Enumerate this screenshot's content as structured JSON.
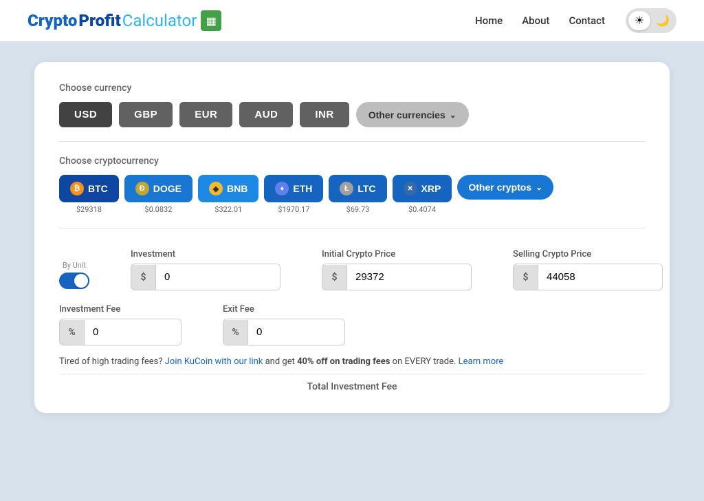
{
  "nav": {
    "logo": {
      "part1": "Crypto",
      "part2": "Profit",
      "part3": "Calculator",
      "icon": "▦"
    },
    "links": [
      {
        "label": "Home",
        "href": "#"
      },
      {
        "label": "About",
        "href": "#"
      },
      {
        "label": "Contact",
        "href": "#"
      }
    ],
    "theme": {
      "light_icon": "☀",
      "dark_icon": "🌙"
    }
  },
  "currency": {
    "section_label": "Choose currency",
    "buttons": [
      {
        "label": "USD",
        "active": true
      },
      {
        "label": "GBP",
        "active": false
      },
      {
        "label": "EUR",
        "active": false
      },
      {
        "label": "AUD",
        "active": false
      },
      {
        "label": "INR",
        "active": false
      }
    ],
    "other_label": "Other currencies",
    "other_icon": "⌄"
  },
  "crypto": {
    "section_label": "Choose cryptocurrency",
    "coins": [
      {
        "id": "btc",
        "label": "BTC",
        "price": "$29318",
        "icon": "₿",
        "icon_class": "coin-btc"
      },
      {
        "id": "doge",
        "label": "DOGE",
        "price": "$0.0832",
        "icon": "Ð",
        "icon_class": "coin-doge"
      },
      {
        "id": "bnb",
        "label": "BNB",
        "price": "$322.01",
        "icon": "◆",
        "icon_class": "coin-bnb"
      },
      {
        "id": "eth",
        "label": "ETH",
        "price": "$1970.17",
        "icon": "♦",
        "icon_class": "coin-eth"
      },
      {
        "id": "ltc",
        "label": "LTC",
        "price": "$69.73",
        "icon": "Ł",
        "icon_class": "coin-ltc"
      },
      {
        "id": "xrp",
        "label": "XRP",
        "price": "$0.4074",
        "icon": "✕",
        "icon_class": "coin-xrp"
      }
    ],
    "other_label": "Other cryptos",
    "other_icon": "⌄"
  },
  "form": {
    "by_unit": "By Unit",
    "investment_label": "Investment",
    "investment_prefix": "$",
    "investment_value": "0",
    "initial_price_label": "Initial Crypto Price",
    "initial_price_prefix": "$",
    "initial_price_value": "29372",
    "selling_price_label": "Selling Crypto Price",
    "selling_price_prefix": "$",
    "selling_price_value": "44058",
    "investment_fee_label": "Investment Fee",
    "investment_fee_prefix": "%",
    "investment_fee_value": "0",
    "exit_fee_label": "Exit Fee",
    "exit_fee_prefix": "%",
    "exit_fee_value": "0",
    "info_text_before": "Tired of high trading fees? ",
    "info_link1": "Join KuCoin with our link",
    "info_text_middle": " and get ",
    "info_bold": "40% off on trading fees",
    "info_text_after": " on EVERY trade. ",
    "info_link2": "Learn more",
    "total_label": "Total Investment Fee"
  }
}
